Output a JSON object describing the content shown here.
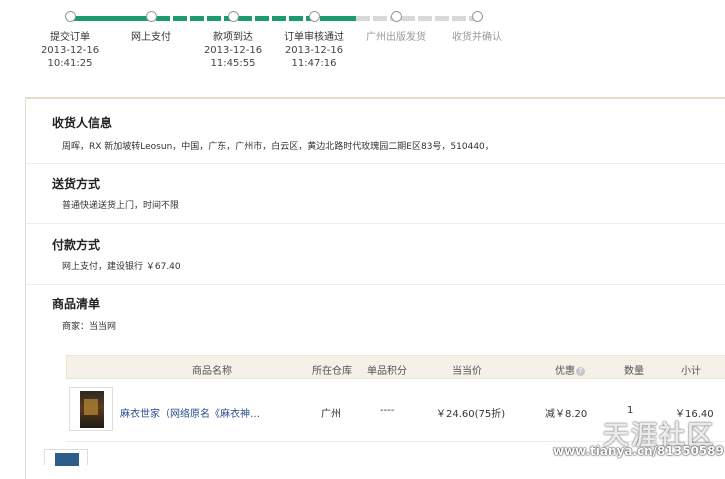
{
  "progress": {
    "steps": [
      {
        "label": "提交订单",
        "date": "2013-12-16",
        "time": "10:41:25"
      },
      {
        "label": "网上支付",
        "date": "",
        "time": ""
      },
      {
        "label": "款项到达",
        "date": "2013-12-16",
        "time": "11:45:55"
      },
      {
        "label": "订单审核通过",
        "date": "2013-12-16",
        "time": "11:47:16"
      },
      {
        "label": "广州出版发货",
        "date": "",
        "time": ""
      },
      {
        "label": "收货并确认",
        "date": "",
        "time": ""
      }
    ],
    "colors": {
      "done": "#1a9c6f",
      "todo": "#d9d9d9"
    }
  },
  "receiver": {
    "title": "收货人信息",
    "detail": "周晖，RX 新加坡转Leosun，中国，广东，广州市，白云区，黄边北路时代玫瑰园二期E区83号，510440，"
  },
  "delivery": {
    "title": "送货方式",
    "detail": "普通快递送货上门，时间不限"
  },
  "payment": {
    "title": "付款方式",
    "detail": "网上支付，建设银行 ￥67.40"
  },
  "goods": {
    "title": "商品清单",
    "merchant": "商家：当当网",
    "columns": {
      "name": "商品名称",
      "warehouse": "所在仓库",
      "points": "单品积分",
      "price": "当当价",
      "discount": "优惠",
      "qty": "数量",
      "subtotal": "小计"
    },
    "items": [
      {
        "name": "麻衣世家（网络原名《麻衣神…",
        "warehouse": "广州",
        "points": "----",
        "price": "￥24.60(75折)",
        "discount": "减￥8.20",
        "qty": "1",
        "subtotal": "￥16.40"
      }
    ]
  },
  "watermark": {
    "brand": "天涯社区",
    "url": "www.tianya.cn/81350589"
  }
}
